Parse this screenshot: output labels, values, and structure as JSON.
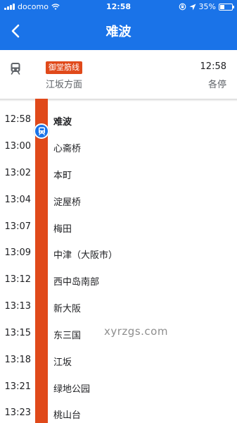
{
  "status_bar": {
    "carrier": "docomo",
    "time": "12:58",
    "battery": "35%",
    "battery_level": 0.35,
    "signal_icon": "signal-bars-icon",
    "wifi_icon": "wifi-icon",
    "lock_icon": "rotation-lock-icon",
    "location_icon": "location-arrow-icon"
  },
  "header": {
    "title": "难波",
    "back_icon": "chevron-left-icon",
    "background": "#1a73e8"
  },
  "route": {
    "line_name": "御堂筋线",
    "line_color": "#e0491a",
    "direction": "江坂方面",
    "departure_time": "12:58",
    "service_type": "各停",
    "train_icon": "train-icon"
  },
  "stops": [
    {
      "time": "12:58",
      "name": "难波",
      "current": true
    },
    {
      "time": "13:00",
      "name": "心斋桥"
    },
    {
      "time": "13:02",
      "name": "本町"
    },
    {
      "time": "13:04",
      "name": "淀屋桥"
    },
    {
      "time": "13:07",
      "name": "梅田"
    },
    {
      "time": "13:09",
      "name": "中津（大阪市）"
    },
    {
      "time": "13:12",
      "name": "西中岛南部"
    },
    {
      "time": "13:13",
      "name": "新大阪"
    },
    {
      "time": "13:15",
      "name": "东三国"
    },
    {
      "time": "13:18",
      "name": "江坂"
    },
    {
      "time": "13:21",
      "name": "绿地公园"
    },
    {
      "time": "13:23",
      "name": "桃山台"
    }
  ],
  "watermark": "xyrzgs.com"
}
